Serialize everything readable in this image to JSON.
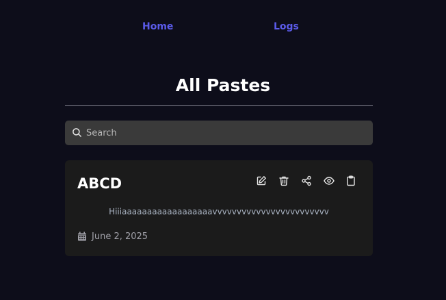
{
  "nav": {
    "home_label": "Home",
    "logs_label": "Logs"
  },
  "page": {
    "title": "All Pastes"
  },
  "search": {
    "placeholder": "Search",
    "value": ""
  },
  "pastes": [
    {
      "title": "ABCD",
      "content": "Hiiiaaaaaaaaaaaaaaaaaavvvvvvvvvvvvvvvvvvvvvvvv",
      "date": "June 2, 2025",
      "actions": [
        "pencil-square-icon",
        "trash-icon",
        "share-icon",
        "eye-icon",
        "clipboard-icon"
      ]
    }
  ],
  "colors": {
    "background": "#0d0d1a",
    "nav_link": "#5b5bea",
    "card": "#1b1b1b",
    "search_bg": "#3a3a3a",
    "divider": "#8a8a96"
  }
}
